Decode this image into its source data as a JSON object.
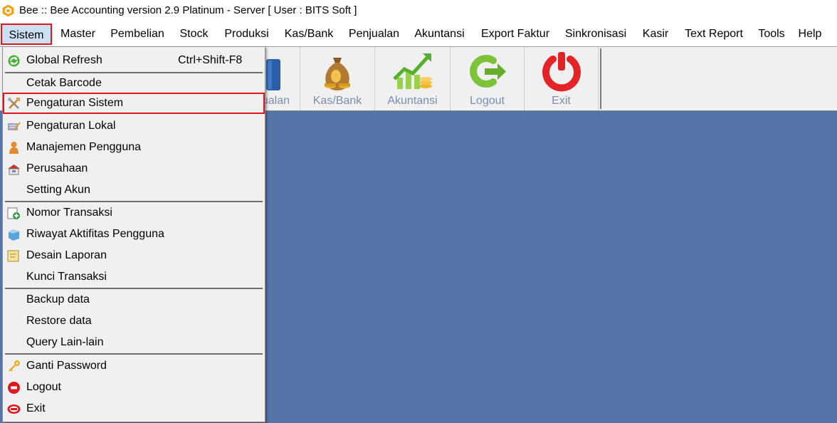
{
  "window": {
    "title": "Bee :: Bee Accounting version 2.9 Platinum - Server  [ User : BITS Soft ]",
    "logo_icon": "bee-logo-icon",
    "accent_color": "#e0161b",
    "desktop_color": "#5474a8"
  },
  "menubar": {
    "items": [
      {
        "label": "Sistem",
        "selected": true
      },
      {
        "label": "Master"
      },
      {
        "label": "Pembelian"
      },
      {
        "label": "Stock"
      },
      {
        "label": "Produksi"
      },
      {
        "label": "Kas/Bank"
      },
      {
        "label": "Penjualan"
      },
      {
        "label": "Akuntansi"
      },
      {
        "label": "Export Faktur"
      },
      {
        "label": "Sinkronisasi"
      },
      {
        "label": "Kasir"
      },
      {
        "label": "Text Report"
      },
      {
        "label": "Tools"
      },
      {
        "label": "Help"
      }
    ]
  },
  "toolbar": {
    "buttons": [
      {
        "label": "jualan",
        "icon": "shopping-bag-icon"
      },
      {
        "label": "Kas/Bank",
        "icon": "money-bag-icon"
      },
      {
        "label": "Akuntansi",
        "icon": "growth-chart-icon"
      },
      {
        "label": "Logout",
        "icon": "logout-icon"
      },
      {
        "label": "Exit",
        "icon": "power-icon"
      }
    ]
  },
  "sistem_menu": {
    "items": [
      {
        "label": "Global Refresh",
        "shortcut": "Ctrl+Shift-F8",
        "icon": "refresh-icon"
      },
      {
        "label": "Cetak Barcode",
        "icon": ""
      },
      {
        "label": "Pengaturan Sistem",
        "icon": "tools-icon",
        "highlighted": true
      },
      {
        "label": "Pengaturan Lokal",
        "icon": "local-settings-icon"
      },
      {
        "label": "Manajemen Pengguna",
        "icon": "user-icon"
      },
      {
        "label": "Perusahaan",
        "icon": "company-icon"
      },
      {
        "label": "Setting Akun",
        "icon": ""
      },
      {
        "label": "Nomor Transaksi",
        "icon": "add-document-icon"
      },
      {
        "label": "Riwayat Aktifitas Pengguna",
        "icon": "history-icon"
      },
      {
        "label": "Desain Laporan",
        "icon": "report-design-icon"
      },
      {
        "label": "Kunci Transaksi",
        "icon": ""
      },
      {
        "label": "Backup data",
        "icon": ""
      },
      {
        "label": "Restore data",
        "icon": ""
      },
      {
        "label": "Query Lain-lain",
        "icon": ""
      },
      {
        "label": "Ganti Password",
        "icon": "key-icon"
      },
      {
        "label": "Logout",
        "icon": "logout-icon"
      },
      {
        "label": "Exit",
        "icon": "exit-icon"
      }
    ]
  }
}
